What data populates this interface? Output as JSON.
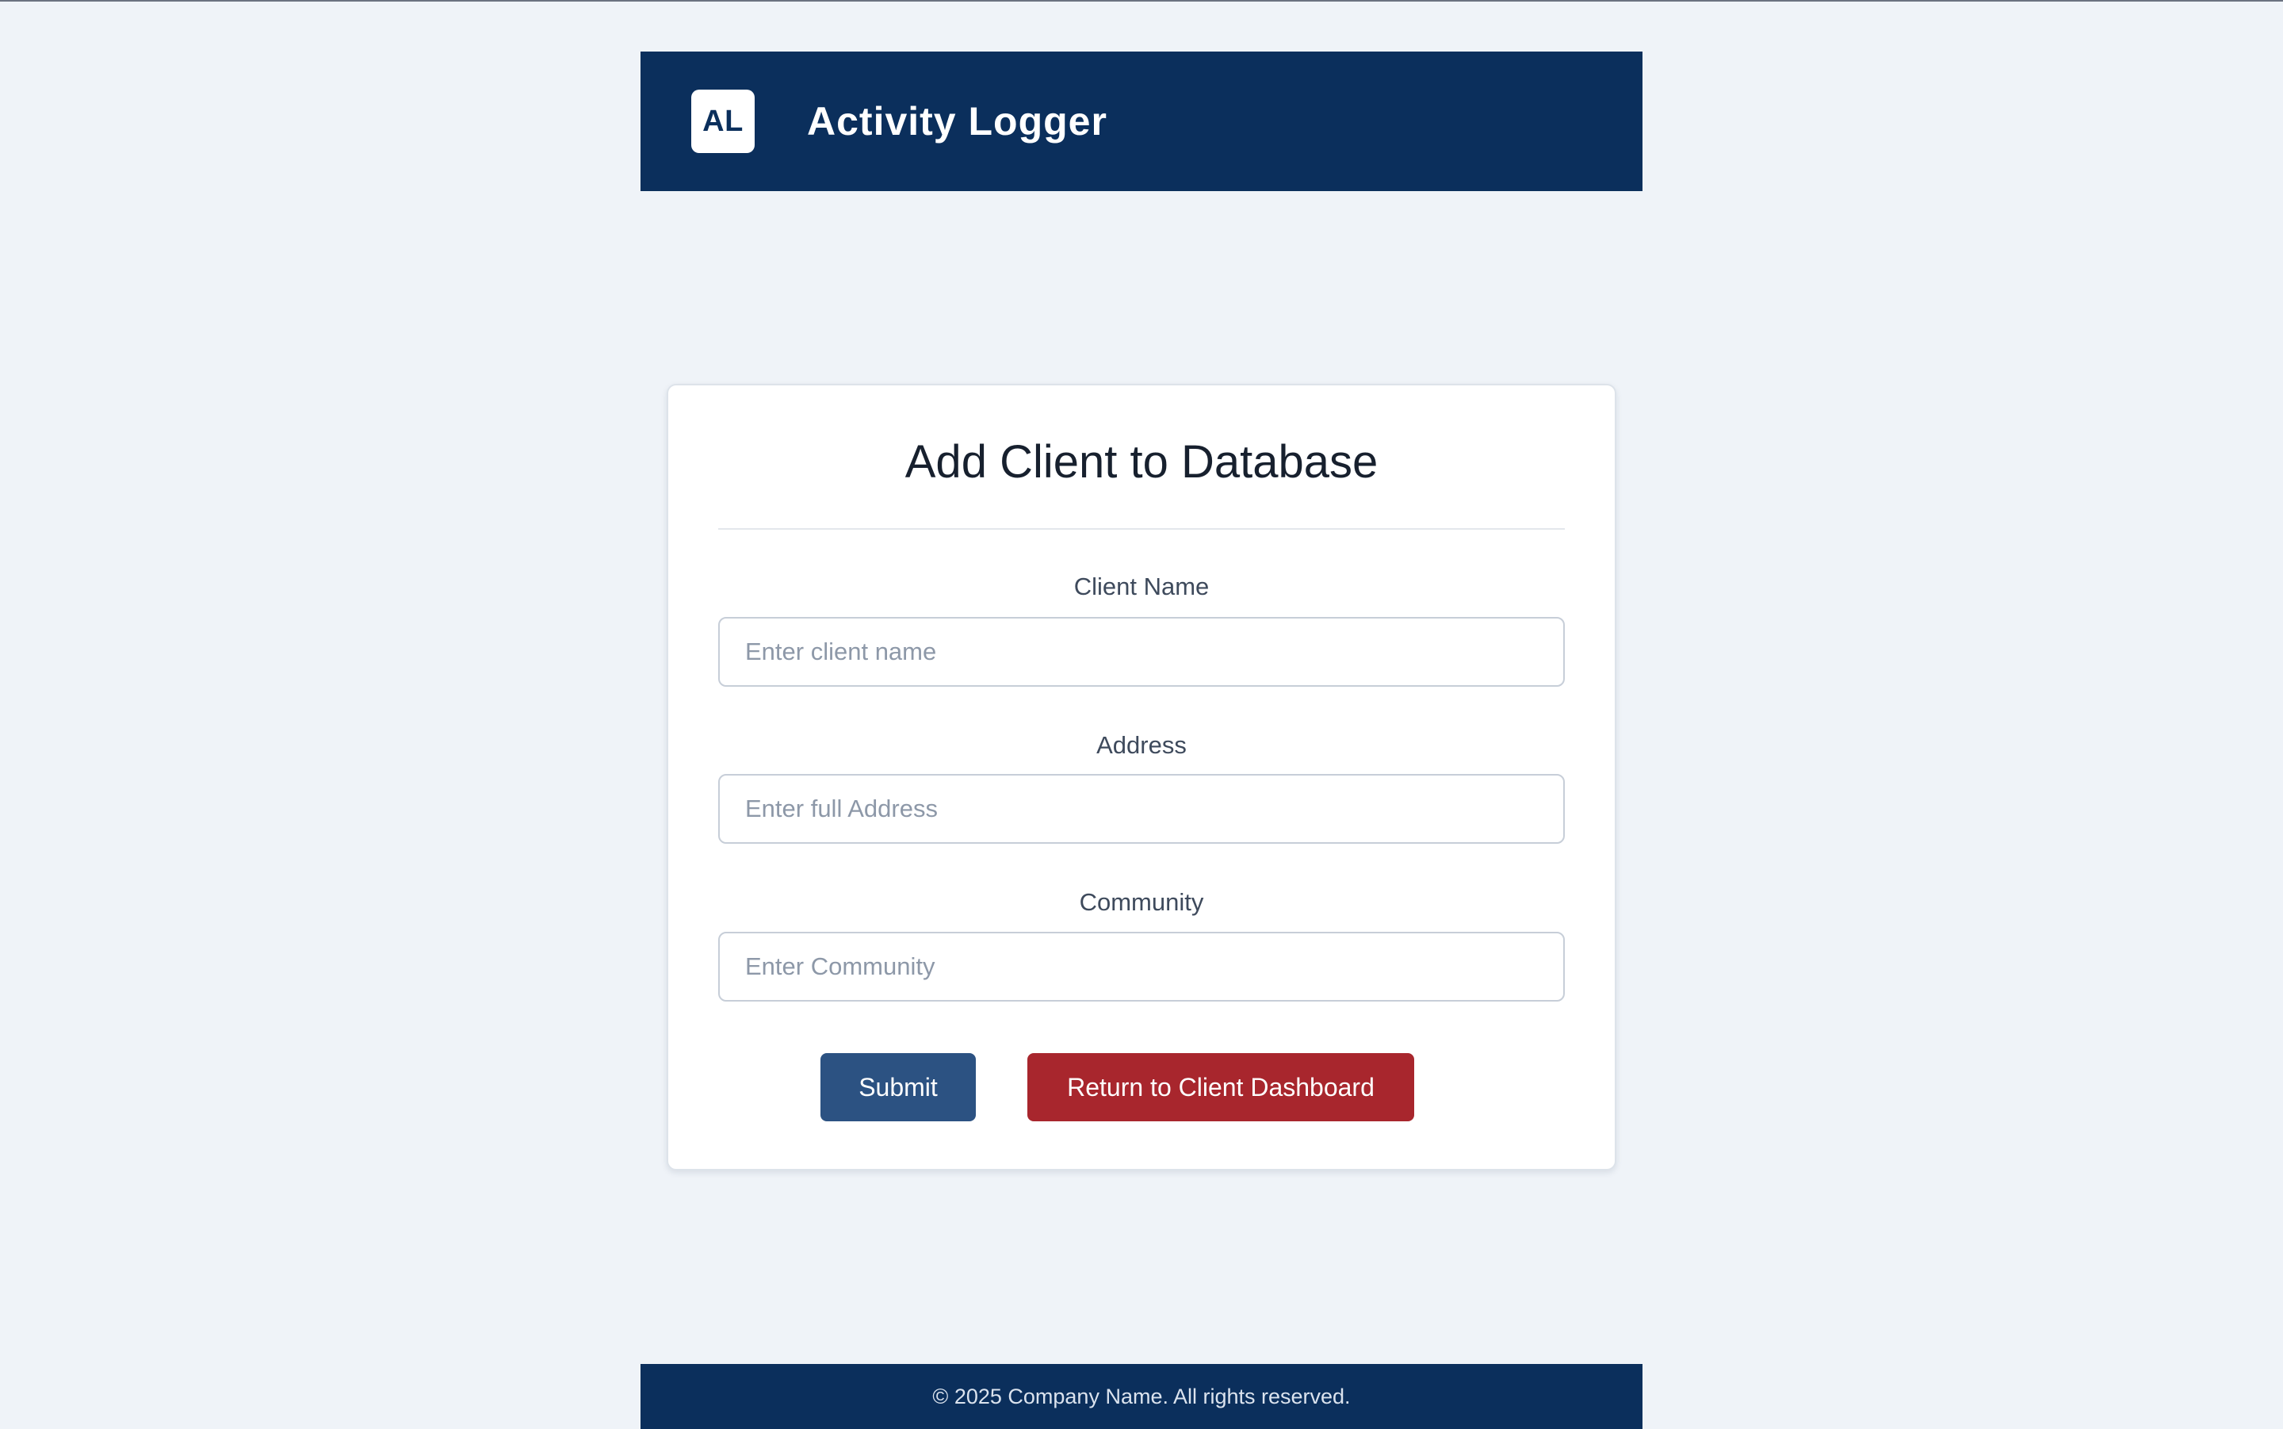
{
  "header": {
    "logo_text": "AL",
    "app_title": "Activity Logger",
    "background_color": "#0b2f5c"
  },
  "form": {
    "title": "Add Client to Database",
    "fields": [
      {
        "label": "Client Name",
        "placeholder": "Enter client name",
        "value": ""
      },
      {
        "label": "Address",
        "placeholder": "Enter full Address",
        "value": ""
      },
      {
        "label": "Community",
        "placeholder": "Enter Community",
        "value": ""
      }
    ],
    "submit_label": "Submit",
    "return_label": "Return to Client Dashboard",
    "submit_color": "#2c5282",
    "return_color": "#a8262d"
  },
  "footer": {
    "text": "© 2025 Company Name. All rights reserved."
  }
}
